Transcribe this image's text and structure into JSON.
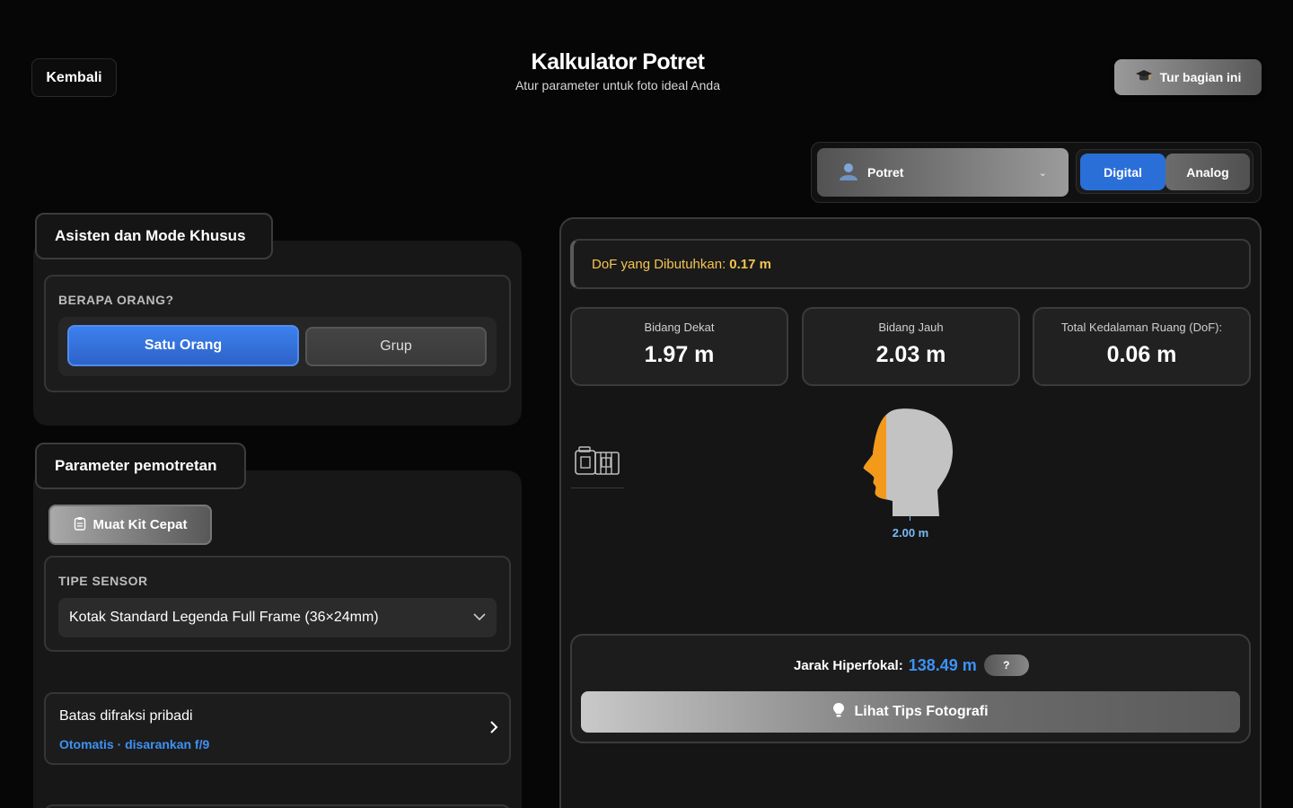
{
  "header": {
    "back_label": "Kembali",
    "title": "Kalkulator Potret",
    "subtitle": "Atur parameter untuk foto ideal Anda",
    "tour_label": "Tur bagian ini",
    "tour_icon": "graduation-cap-icon"
  },
  "mode": {
    "selected": "Potret",
    "icon": "person-icon",
    "format_options": [
      "Digital",
      "Analog"
    ],
    "active_format": "Digital"
  },
  "assistant": {
    "section_title": "Asisten dan Mode Khusus",
    "people_label": "BERAPA ORANG?",
    "option_single": "Satu Orang",
    "option_group": "Grup",
    "active_option": "Satu Orang"
  },
  "parameters": {
    "section_title": "Parameter pemotretan",
    "quick_kit_label": "Muat Kit Cepat",
    "sensor_label": "TIPE SENSOR",
    "sensor_value": "Kotak Standard Legenda Full Frame (36×24mm)",
    "diffraction_title": "Batas difraksi pribadi",
    "diffraction_sub": "Otomatis · disarankan f/9"
  },
  "results": {
    "dof_required_label": "DoF yang Dibutuhkan:",
    "dof_required_value": "0.17 m",
    "near_label": "Bidang Dekat",
    "near_value": "1.97 m",
    "far_label": "Bidang Jauh",
    "far_value": "2.03 m",
    "total_label": "Total Kedalaman Ruang (DoF):",
    "total_value": "0.06 m",
    "subject_distance": "2.00 m",
    "hyperfocal_label": "Jarak Hiperfokal:",
    "hyperfocal_value": "138.49 m",
    "help_label": "?",
    "tips_label": "Lihat Tips Fotografi"
  },
  "colors": {
    "accent_blue": "#2a6fd8",
    "highlight_yellow": "#f5c451",
    "focus_orange": "#f39a1a",
    "value_blue": "#3d92f5"
  }
}
